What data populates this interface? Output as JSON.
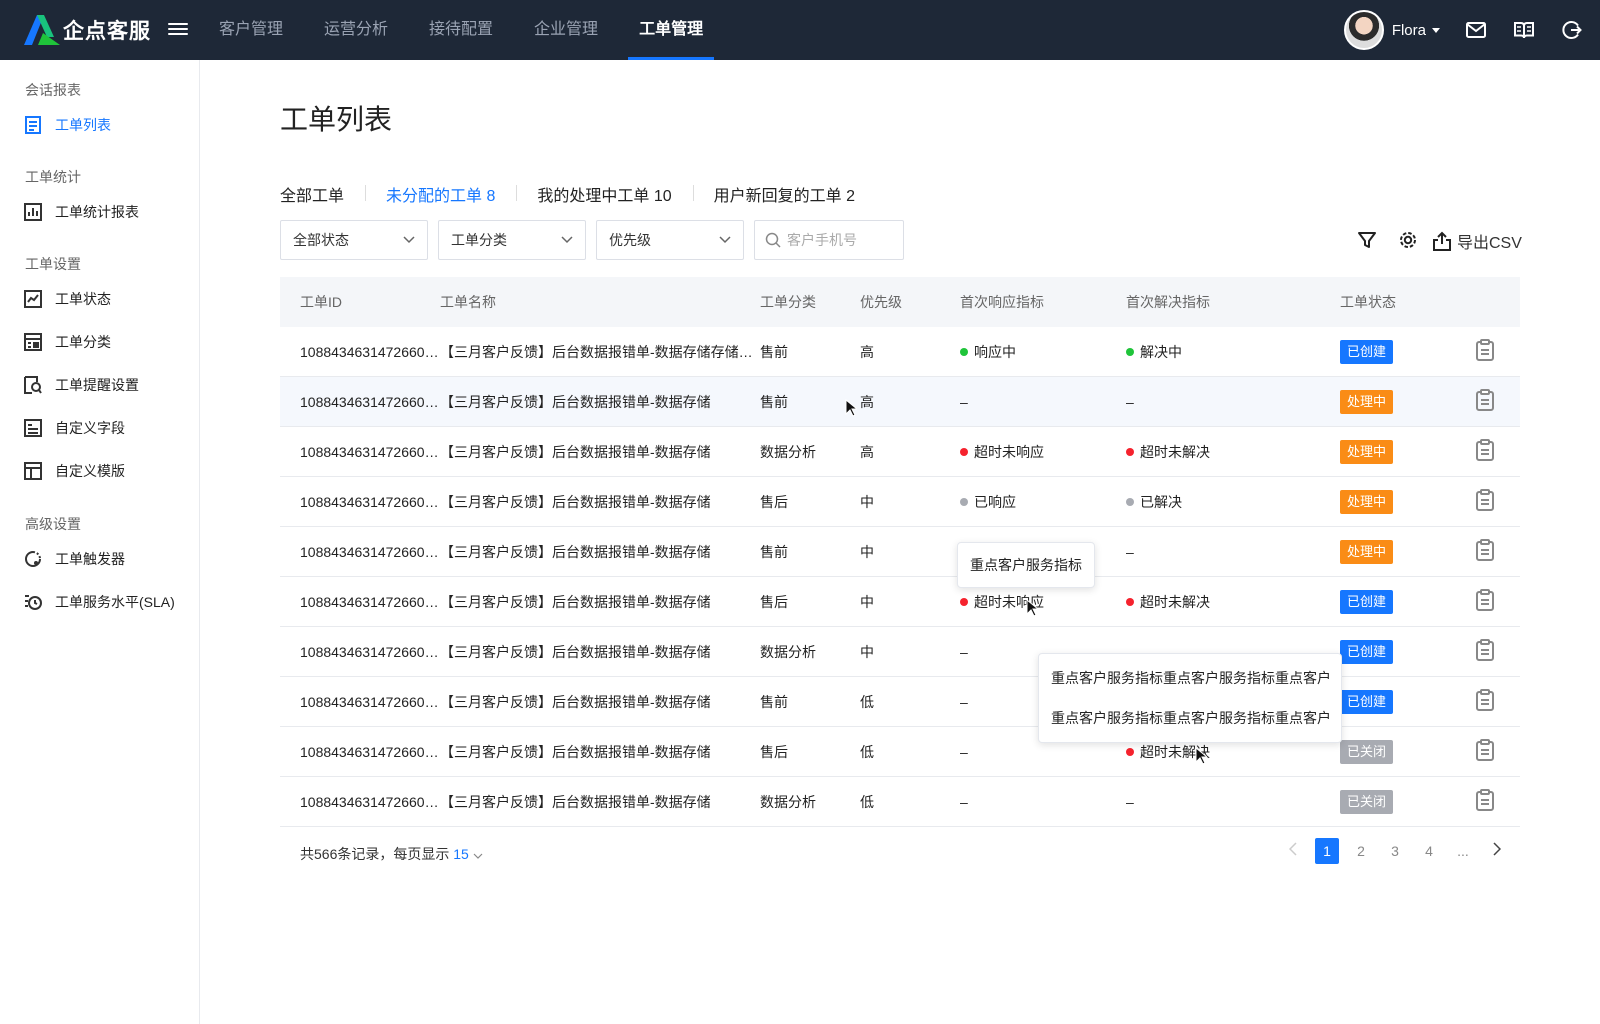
{
  "app": {
    "name": "企点客服"
  },
  "nav": [
    "客户管理",
    "运营分析",
    "接待配置",
    "企业管理",
    "工单管理"
  ],
  "nav_active": 4,
  "user": {
    "name": "Flora"
  },
  "sidebar": {
    "groups": [
      "会话报表",
      "工单统计",
      "工单设置",
      "高级设置"
    ],
    "items": [
      {
        "label": "工单列表",
        "icon": "list-icon",
        "active": true
      },
      {
        "label": "工单统计报表",
        "icon": "bar-chart-icon"
      },
      {
        "label": "工单状态",
        "icon": "line-chart-icon"
      },
      {
        "label": "工单分类",
        "icon": "category-icon"
      },
      {
        "label": "工单提醒设置",
        "icon": "bell-icon"
      },
      {
        "label": "自定义字段",
        "icon": "field-icon"
      },
      {
        "label": "自定义模版",
        "icon": "template-icon"
      },
      {
        "label": "工单触发器",
        "icon": "trigger-icon"
      },
      {
        "label": "工单服务水平(SLA)",
        "icon": "clock-icon"
      }
    ]
  },
  "page_title": "工单列表",
  "tabs": [
    "全部工单",
    "未分配的工单 8",
    "我的处理中工单 10",
    "用户新回复的工单 2"
  ],
  "tab_active": 1,
  "filters": {
    "status": "全部状态",
    "category": "工单分类",
    "priority": "优先级",
    "search_placeholder": "客户手机号"
  },
  "export_label": "导出CSV",
  "table": {
    "columns": [
      "工单ID",
      "工单名称",
      "工单分类",
      "优先级",
      "首次响应指标",
      "首次解决指标",
      "工单状态"
    ],
    "rows": [
      {
        "id": "108843463147266048",
        "name": "【三月客户反馈】后台数据报错单-数据存储存储存储",
        "category": "售前",
        "priority": "高",
        "response": "响应中",
        "response_color": "#1fc43a",
        "resolve": "解决中",
        "resolve_color": "#1fc43a",
        "status": "已创建",
        "status_color": "#1677ff"
      },
      {
        "id": "108843463147266048",
        "name": "【三月客户反馈】后台数据报错单-数据存储",
        "category": "售前",
        "priority": "高",
        "response": "–",
        "response_color": "",
        "resolve": "–",
        "resolve_color": "",
        "status": "处理中",
        "status_color": "#fa8c16"
      },
      {
        "id": "108843463147266048",
        "name": "【三月客户反馈】后台数据报错单-数据存储",
        "category": "数据分析",
        "priority": "高",
        "response": "超时未响应",
        "response_color": "#f5222d",
        "resolve": "超时未解决",
        "resolve_color": "#f5222d",
        "status": "处理中",
        "status_color": "#fa8c16"
      },
      {
        "id": "108843463147266048",
        "name": "【三月客户反馈】后台数据报错单-数据存储",
        "category": "售后",
        "priority": "中",
        "response": "已响应",
        "response_color": "#a8abb2",
        "resolve": "已解决",
        "resolve_color": "#a8abb2",
        "status": "处理中",
        "status_color": "#fa8c16"
      },
      {
        "id": "108843463147266048",
        "name": "【三月客户反馈】后台数据报错单-数据存储",
        "category": "售前",
        "priority": "中",
        "response": "",
        "response_color": "",
        "resolve": "–",
        "resolve_color": "",
        "status": "处理中",
        "status_color": "#fa8c16"
      },
      {
        "id": "108843463147266048",
        "name": "【三月客户反馈】后台数据报错单-数据存储",
        "category": "售后",
        "priority": "中",
        "response": "超时未响应",
        "response_color": "#f5222d",
        "resolve": "超时未解决",
        "resolve_color": "#f5222d",
        "status": "已创建",
        "status_color": "#1677ff"
      },
      {
        "id": "108843463147266048",
        "name": "【三月客户反馈】后台数据报错单-数据存储",
        "category": "数据分析",
        "priority": "中",
        "response": "–",
        "response_color": "",
        "resolve": "",
        "resolve_color": "",
        "status": "已创建",
        "status_color": "#1677ff"
      },
      {
        "id": "108843463147266048",
        "name": "【三月客户反馈】后台数据报错单-数据存储",
        "category": "售前",
        "priority": "低",
        "response": "–",
        "response_color": "",
        "resolve": "",
        "resolve_color": "",
        "status": "已创建",
        "status_color": "#1677ff"
      },
      {
        "id": "108843463147266048",
        "name": "【三月客户反馈】后台数据报错单-数据存储",
        "category": "售后",
        "priority": "低",
        "response": "–",
        "response_color": "",
        "resolve": "超时未解决",
        "resolve_color": "#f5222d",
        "status": "已关闭",
        "status_color": "#a8abb2"
      },
      {
        "id": "108843463147266048",
        "name": "【三月客户反馈】后台数据报错单-数据存储",
        "category": "数据分析",
        "priority": "低",
        "response": "–",
        "response_color": "",
        "resolve": "–",
        "resolve_color": "",
        "status": "已关闭",
        "status_color": "#a8abb2"
      }
    ]
  },
  "footer": {
    "summary": "共566条记录，每页显示",
    "page_size": "15"
  },
  "pagination": {
    "pages": [
      "1",
      "2",
      "3",
      "4",
      "..."
    ],
    "current": "1"
  },
  "tooltips": {
    "response_tip": "重点客户服务指标",
    "resolve_tip": [
      "重点客户服务指标重点客户服务指标重点客户",
      "重点客户服务指标重点客户服务指标重点客户"
    ]
  }
}
